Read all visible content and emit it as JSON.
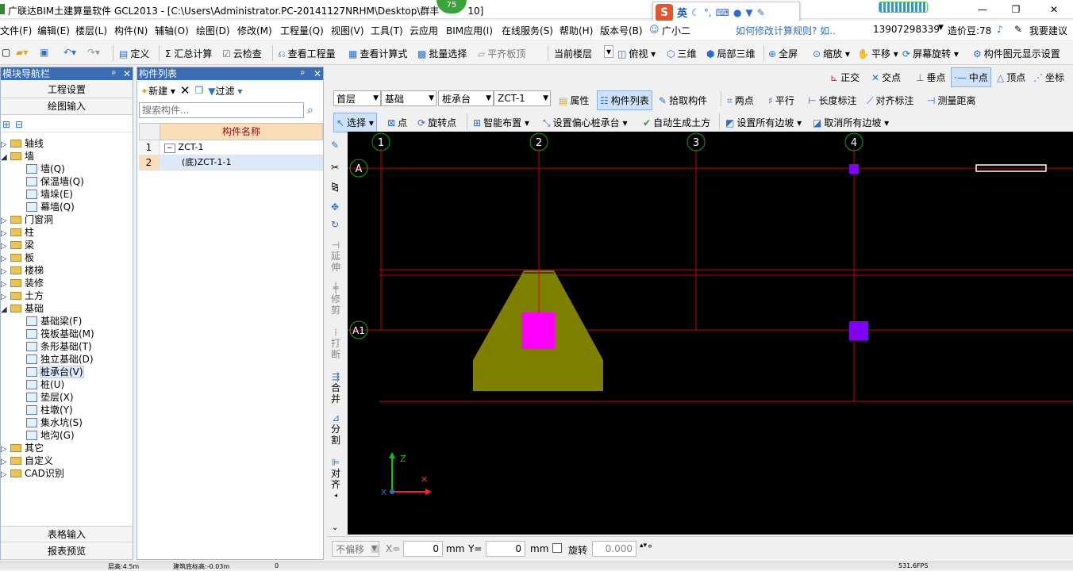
{
  "window": {
    "title": "广联达BIM土建算量软件 GCL2013 - [C:\\Users\\Administrator.PC-20141127NRHM\\Desktop\\群丰",
    "title_tail": "10]",
    "badge": "75",
    "ime": {
      "logo": "S",
      "lang": "英"
    }
  },
  "menu": [
    "文件(F)",
    "编辑(E)",
    "楼层(L)",
    "构件(N)",
    "辅轴(O)",
    "绘图(D)",
    "修改(M)",
    "工程量(Q)",
    "视图(V)",
    "工具(T)",
    "云应用",
    "BIM应用(I)",
    "在线服务(S)",
    "帮助(H)",
    "版本号(B)",
    "广小二",
    "如何修改计算规则? 如..",
    "13907298339",
    "造价豆:78",
    "我要建议"
  ],
  "toolbar1": [
    "定义",
    "Σ 汇总计算",
    "云检查",
    "查看工程量",
    "查看计算式",
    "批量选择",
    "平齐板顶",
    "当前楼层",
    "俯视",
    "三维",
    "局部三维",
    "全屏",
    "缩放",
    "平移",
    "屏幕旋转",
    "构件图元显示设置"
  ],
  "nav": {
    "title": "模块导航栏",
    "buttons": [
      "工程设置",
      "绘图输入"
    ],
    "tree": [
      {
        "label": "轴线",
        "level": 0,
        "type": "folder",
        "mark": "+"
      },
      {
        "label": "墙",
        "level": 0,
        "type": "folder",
        "mark": "-"
      },
      {
        "label": "墙(Q)",
        "level": 1,
        "type": "item"
      },
      {
        "label": "保温墙(Q)",
        "level": 1,
        "type": "item"
      },
      {
        "label": "墙垛(E)",
        "level": 1,
        "type": "item"
      },
      {
        "label": "幕墙(Q)",
        "level": 1,
        "type": "item"
      },
      {
        "label": "门窗洞",
        "level": 0,
        "type": "folder",
        "mark": "+"
      },
      {
        "label": "柱",
        "level": 0,
        "type": "folder",
        "mark": "+"
      },
      {
        "label": "梁",
        "level": 0,
        "type": "folder",
        "mark": "+"
      },
      {
        "label": "板",
        "level": 0,
        "type": "folder",
        "mark": "+"
      },
      {
        "label": "楼梯",
        "level": 0,
        "type": "folder",
        "mark": "+"
      },
      {
        "label": "装修",
        "level": 0,
        "type": "folder",
        "mark": "+"
      },
      {
        "label": "土方",
        "level": 0,
        "type": "folder",
        "mark": "+"
      },
      {
        "label": "基础",
        "level": 0,
        "type": "folder",
        "mark": "-"
      },
      {
        "label": "基础梁(F)",
        "level": 1,
        "type": "item"
      },
      {
        "label": "筏板基础(M)",
        "level": 1,
        "type": "item"
      },
      {
        "label": "条形基础(T)",
        "level": 1,
        "type": "item"
      },
      {
        "label": "独立基础(D)",
        "level": 1,
        "type": "item"
      },
      {
        "label": "桩承台(V)",
        "level": 1,
        "type": "item",
        "selected": true
      },
      {
        "label": "桩(U)",
        "level": 1,
        "type": "item"
      },
      {
        "label": "垫层(X)",
        "level": 1,
        "type": "item"
      },
      {
        "label": "柱墩(Y)",
        "level": 1,
        "type": "item"
      },
      {
        "label": "集水坑(S)",
        "level": 1,
        "type": "item"
      },
      {
        "label": "地沟(G)",
        "level": 1,
        "type": "item"
      },
      {
        "label": "其它",
        "level": 0,
        "type": "folder",
        "mark": "+"
      },
      {
        "label": "自定义",
        "level": 0,
        "type": "folder",
        "mark": "+"
      },
      {
        "label": "CAD识别",
        "level": 0,
        "type": "folder",
        "mark": "+"
      }
    ],
    "bottom_buttons": [
      "表格输入",
      "报表预览"
    ]
  },
  "list": {
    "title": "构件列表",
    "new_label": "新建",
    "filter_label": "过滤",
    "search_placeholder": "搜索构件...",
    "column": "构件名称",
    "rows": [
      {
        "num": "1",
        "name": "ZCT-1",
        "mark": "-"
      },
      {
        "num": "2",
        "name": "(底)ZCT-1-1",
        "selected": true
      }
    ]
  },
  "snap": [
    "正交",
    "交点",
    "垂点",
    "中点",
    "顶点",
    "坐标"
  ],
  "toolbar2": {
    "floor": "首层",
    "type": "基础",
    "sub": "桩承台",
    "comp": "ZCT-1",
    "buttons": [
      "属性",
      "构件列表",
      "拾取构件",
      "两点",
      "平行",
      "长度标注",
      "对齐标注",
      "测量距离"
    ]
  },
  "toolbar3": [
    "选择",
    "点",
    "旋转点",
    "智能布置",
    "设置偏心桩承台",
    "自动生成土方",
    "设置所有边坡",
    "取消所有边坡"
  ],
  "vtools": [
    "延伸",
    "修剪",
    "打断",
    "合并",
    "分割",
    "对齐"
  ],
  "axes": {
    "cols": [
      "1",
      "2",
      "3",
      "4"
    ],
    "rows": [
      "A",
      "A1"
    ]
  },
  "coord": {
    "X": "X",
    "Y": "Z"
  },
  "bottom": {
    "offset": "不偏移",
    "x_label": "X=",
    "x_val": "0",
    "mm1": "mm",
    "y_label": "Y=",
    "y_val": "0",
    "mm2": "mm",
    "rotate": "旋转",
    "angle": "0.000",
    "deg": "°"
  },
  "status": [
    "层高:4.5m",
    "建筑底标高:-0.03m",
    "0",
    "531.6FPS"
  ],
  "colors": {
    "canvas": "#000000",
    "grid": "#cc0000",
    "cap": "#808000",
    "pile": "#ff00ff",
    "pile2": "#8000ff",
    "axis_circle": "#00aa00"
  }
}
